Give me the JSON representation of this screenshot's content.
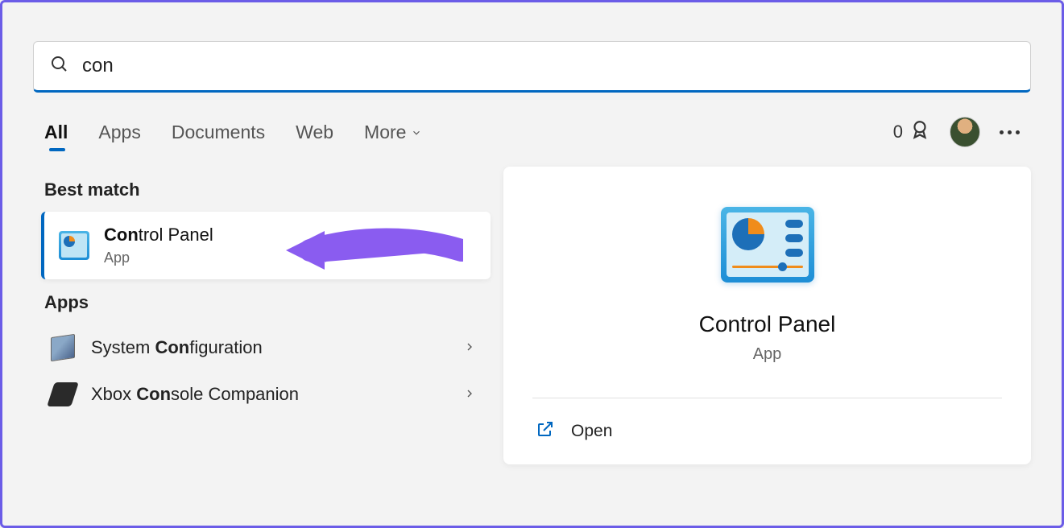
{
  "search": {
    "query": "con"
  },
  "tabs": {
    "all": "All",
    "apps": "Apps",
    "documents": "Documents",
    "web": "Web",
    "more": "More"
  },
  "points": {
    "count": "0"
  },
  "sections": {
    "best_match": "Best match",
    "apps": "Apps"
  },
  "best_match": {
    "title_bold": "Con",
    "title_rest": "trol Panel",
    "subtitle": "App"
  },
  "app_results": [
    {
      "icon": "system-configuration-icon",
      "prefix": "System ",
      "bold": "Con",
      "suffix": "figuration"
    },
    {
      "icon": "xbox-console-icon",
      "prefix": "Xbox ",
      "bold": "Con",
      "suffix": "sole Companion"
    }
  ],
  "preview": {
    "title": "Control Panel",
    "subtitle": "App",
    "open": "Open"
  }
}
